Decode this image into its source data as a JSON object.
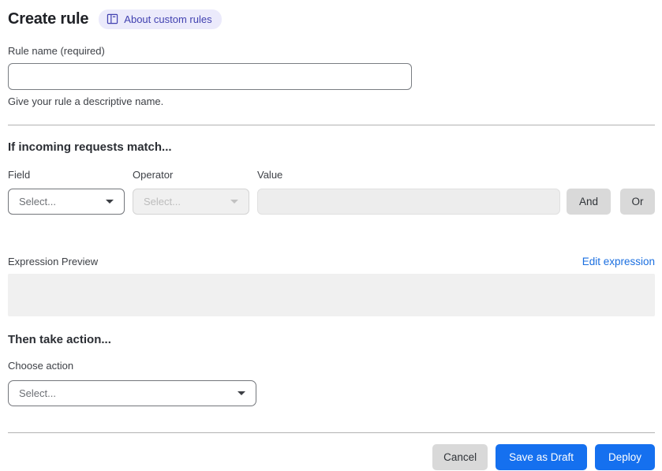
{
  "page": {
    "title": "Create rule",
    "badge": {
      "label": "About custom rules"
    }
  },
  "rule_name": {
    "label": "Rule name (required)",
    "value": "",
    "help": "Give your rule a descriptive name."
  },
  "match_section": {
    "heading": "If incoming requests match...",
    "field": {
      "label": "Field",
      "placeholder": "Select..."
    },
    "operator": {
      "label": "Operator",
      "placeholder": "Select..."
    },
    "value": {
      "label": "Value",
      "value": ""
    },
    "and_label": "And",
    "or_label": "Or",
    "expression_preview_label": "Expression Preview",
    "edit_expression_label": "Edit expression",
    "expression_value": ""
  },
  "action_section": {
    "heading": "Then take action...",
    "choose_label": "Choose action",
    "placeholder": "Select..."
  },
  "footer": {
    "cancel_label": "Cancel",
    "save_draft_label": "Save as Draft",
    "deploy_label": "Deploy"
  },
  "colors": {
    "primary_blue": "#1570ef",
    "link_blue": "#1b6fe0",
    "badge_bg": "#ebeafb",
    "badge_text": "#4141b0",
    "neutral_button_bg": "#d9d9d9",
    "disabled_bg": "#f0f0f0"
  }
}
